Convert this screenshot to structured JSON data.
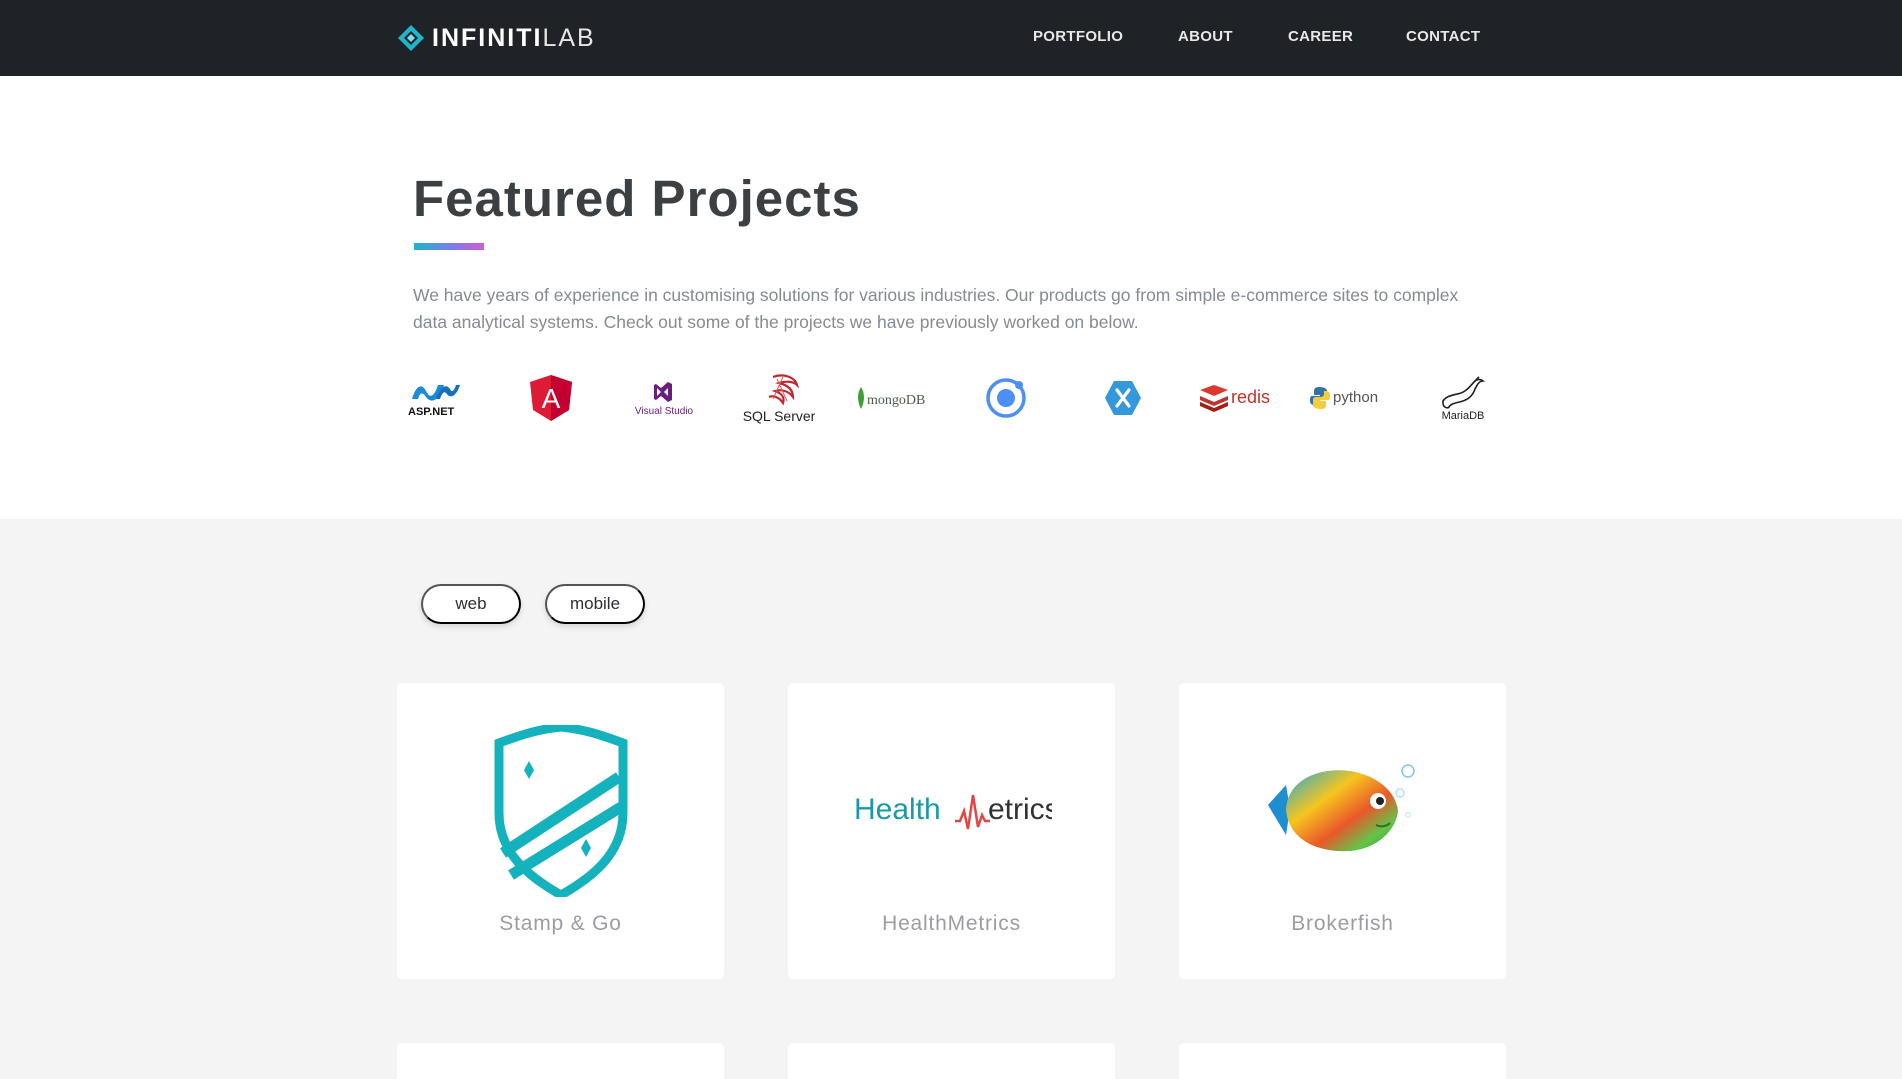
{
  "nav": {
    "brand_bold": "INFINITI",
    "brand_light": "LAB",
    "links": [
      "PORTFOLIO",
      "ABOUT",
      "CAREER",
      "CONTACT"
    ]
  },
  "intro": {
    "title": "Featured Projects",
    "description": "We have years of experience in customising solutions for various industries. Our products go from simple e-commerce sites to complex data analytical systems. Check out some of the projects we have previously worked on below."
  },
  "tech_logos": {
    "aspnet": "ASP.NET",
    "angular": "A",
    "visualstudio": "Visual Studio",
    "sqlserver": "SQL Server",
    "mongodb": "mongoDB",
    "redis": "redis",
    "python": "python",
    "mariadb": "MariaDB"
  },
  "filters": [
    "web",
    "mobile"
  ],
  "projects": [
    {
      "name": "Stamp & Go",
      "icon": "shield-icon"
    },
    {
      "name": "HealthMetrics",
      "logo_left": "Health",
      "logo_right": "etrics",
      "icon": "heartbeat-icon"
    },
    {
      "name": "Brokerfish",
      "icon": "fish-icon"
    }
  ],
  "colors": {
    "navbar": "#1f2226",
    "accent_teal": "#1fb6c9",
    "accent_purple": "#d45ad7",
    "section_bg": "#f4f4f4"
  }
}
